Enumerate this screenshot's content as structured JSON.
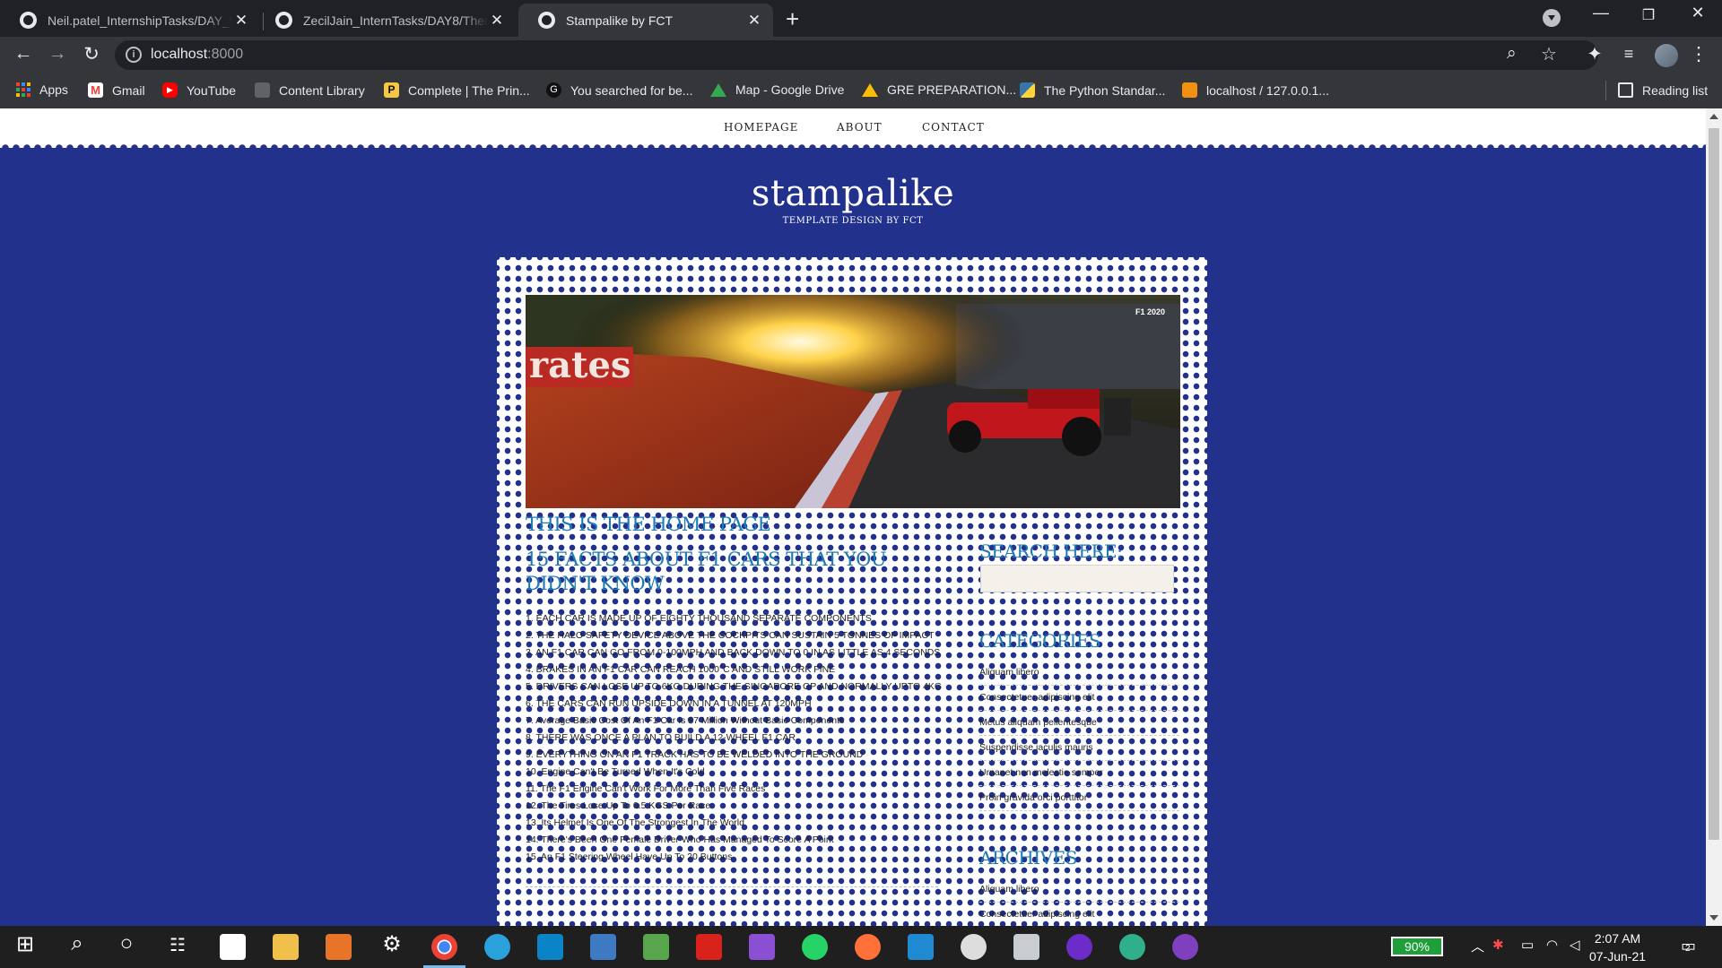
{
  "browser": {
    "tabs": [
      {
        "title": "Neil.patel_InternshipTasks/DAY_9",
        "close": "✕"
      },
      {
        "title": "ZecilJain_InternTasks/DAY8/Them",
        "close": "✕"
      },
      {
        "title": "Stampalike by FCT",
        "close": "✕"
      }
    ],
    "url_host": "localhost",
    "url_port": ":8000",
    "bookmarks": [
      {
        "label": "Apps",
        "color": "#4285f4"
      },
      {
        "label": "Gmail",
        "color": "#ea4335"
      },
      {
        "label": "YouTube",
        "color": "#ff0000"
      },
      {
        "label": "Content Library",
        "color": "#9aa0a6"
      },
      {
        "label": "Complete | The Prin...",
        "color": "#f6c744"
      },
      {
        "label": "You searched for be...",
        "color": "#111111"
      },
      {
        "label": "Map - Google Drive",
        "color": "#34a853"
      },
      {
        "label": "GRE PREPARATION...",
        "color": "#fbbc04"
      },
      {
        "label": "The Python Standar...",
        "color": "#3776ab"
      },
      {
        "label": "localhost / 127.0.0.1...",
        "color": "#f29111"
      }
    ],
    "reading_list": "Reading list"
  },
  "site": {
    "nav": [
      "HOMEPAGE",
      "ABOUT",
      "CONTACT"
    ],
    "brand": "stampalike",
    "tagline": "TEMPLATE DESIGN BY FCT",
    "page_heading": "THIS IS THE HOME PAGE",
    "post_title": "15 FACTS ABOUT F1 CARS THAT YOU DIDN'T KNOW",
    "facts": [
      "1. EACH CAR IS MADE UP OF EIGHTY THOUSAND SEPARATE COMPONENTS",
      "2. THE HALO SAFETY DEVICE ABOVE THE COCKPITS CAN SUSTAIN 5 TONNES OF IMPACT",
      "3. AN F1 CAR CAN GO FROM 0-100MPH AND BACK DOWN TO 0 IN AS LITTLE AS 4 SECONDS",
      "4. BRAKES IN AN F1 CAR CAN REACH 1000°C AND STILL WORK FINE",
      "5. DRIVERS CAN LOSE UP TO 6KG DURING THE SINGAPORE GP AND NORMALLY UPTO 4KG",
      "6. THE CARS CAN RUN UPSIDE DOWN IN A TUNNEL AT 120MPH",
      "7. Average Basic Cost Of An F1 Car Is $7 Million Without Basic Components",
      "8. THERE WAS ONCE A PLAN TO BUILD A 12-WHEEL F1 CAR",
      "9. EVERYTHING ON AN F1 TRACK HAS TO BE WELDED INTO THE GROUND",
      "10. Engine Can't Be Turned When It's Cold",
      "11. The F1 Engine Can't Work For More Than Five Races",
      "12. The Tires Lose Up To 0.5 KGS Per Race",
      "13. Its Helmet Is One Of The Strongest In The World",
      "14. There's Been One Female Driver Who Has Managed To Score A Point",
      "15. An F1 Steering Wheel Have Up To 20 Buttons"
    ],
    "sidebar": {
      "search_heading": "SEARCH HERE:",
      "categories_heading": "CATEGORIES",
      "categories": [
        "Aliquam libero",
        "Consectetuer adipiscing elit",
        "Metus aliquam pellentesque",
        "Suspendisse iaculis mauris",
        "Urnanet non molestie semper",
        "Proin gravida orci porttitor"
      ],
      "archives_heading": "ARCHIVES",
      "archives": [
        "Aliquam libero",
        "Consectetuer adipiscing elit"
      ]
    },
    "hero_banner_text": "rates",
    "hero_badge": "F1 2020"
  },
  "taskbar": {
    "battery": "90%",
    "time": "2:07 AM",
    "date": "07-Jun-21",
    "notification_count": "2",
    "accent": "#76b9ed"
  }
}
